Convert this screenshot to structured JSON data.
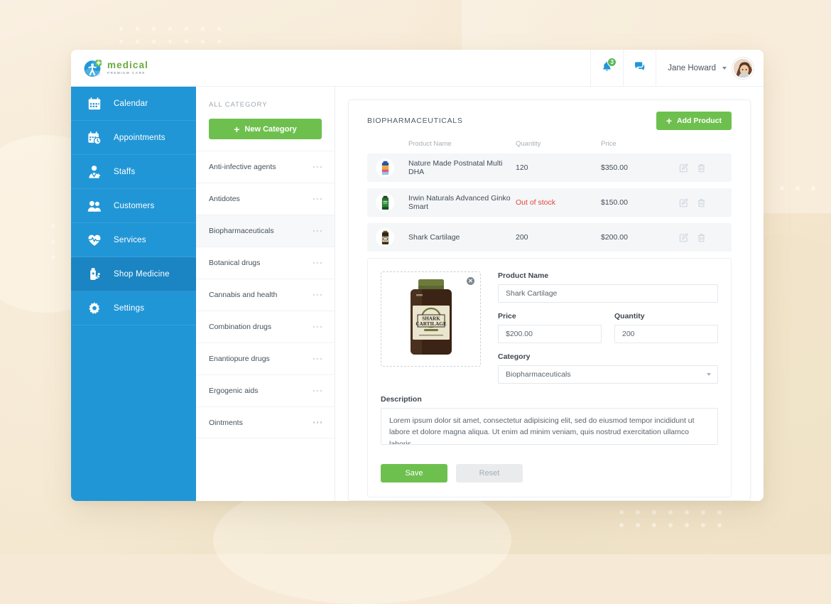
{
  "brand": {
    "title": "medical",
    "subtitle": "PREMIUM CARE",
    "logo_icon": "medical-globe-logo",
    "title_color": "#6aab3f",
    "accent_blue": "#2196d6"
  },
  "topbar": {
    "notifications": {
      "icon": "bell-icon",
      "badge_count": "3",
      "badge_color": "#5cb85c"
    },
    "messages": {
      "icon": "chat-bubble-icon"
    },
    "user": {
      "name": "Jane Howard",
      "caret_icon": "chevron-down-icon",
      "avatar_icon": "user-avatar"
    }
  },
  "sidebar": {
    "background": "#2196d6",
    "active_background": "#1a85c2",
    "items": [
      {
        "label": "Calendar",
        "icon": "calendar-icon",
        "active": false
      },
      {
        "label": "Appointments",
        "icon": "appointments-icon",
        "active": false
      },
      {
        "label": "Staffs",
        "icon": "staff-icon",
        "active": false
      },
      {
        "label": "Customers",
        "icon": "customers-icon",
        "active": false
      },
      {
        "label": "Services",
        "icon": "heart-pulse-icon",
        "active": false
      },
      {
        "label": "Shop Medicine",
        "icon": "medicine-bottle-icon",
        "active": true
      },
      {
        "label": "Settings",
        "icon": "gear-icon",
        "active": false
      }
    ]
  },
  "categories": {
    "header": "ALL CATEGORY",
    "new_button": {
      "label": "New Category",
      "icon": "plus-icon",
      "color": "#6ec04e"
    },
    "menu_icon": "three-dots-icon",
    "items": [
      {
        "label": "Anti-infective agents",
        "active": false
      },
      {
        "label": "Antidotes",
        "active": false
      },
      {
        "label": "Biopharmaceuticals",
        "active": true
      },
      {
        "label": "Botanical drugs",
        "active": false
      },
      {
        "label": "Cannabis and health",
        "active": false
      },
      {
        "label": "Combination drugs",
        "active": false
      },
      {
        "label": "Enantiopure drugs",
        "active": false
      },
      {
        "label": "Ergogenic aids",
        "active": false
      },
      {
        "label": "Ointments",
        "active": false
      }
    ]
  },
  "products_panel": {
    "title": "BIOPHARMACEUTICALS",
    "add_button": {
      "label": "Add Product",
      "icon": "plus-icon",
      "color": "#6ec04e"
    },
    "columns": {
      "product_name": "Product Name",
      "quantity": "Quantity",
      "price": "Price"
    },
    "out_of_stock_color": "#e8453c",
    "row_icons": {
      "edit": "edit-square-icon",
      "delete": "trash-icon"
    },
    "rows": [
      {
        "name": "Nature Made Postnatal Multi DHA",
        "quantity": "120",
        "out_of_stock": false,
        "price": "$350.00",
        "thumb": "multivitamin-bottle-yellow"
      },
      {
        "name": "Irwin Naturals Advanced Ginko Smart",
        "quantity": "Out of stock",
        "out_of_stock": true,
        "price": "$150.00",
        "thumb": "ginko-bottle-green"
      },
      {
        "name": "Shark Cartilage",
        "quantity": "200",
        "out_of_stock": false,
        "price": "$200.00",
        "thumb": "shark-cartilage-bottle-brown"
      }
    ]
  },
  "edit_form": {
    "image": {
      "alt": "shark-cartilage-bottle-image",
      "remove_icon": "close-circle-icon",
      "label_line1": "SHARK",
      "label_line2": "CARTILAGE"
    },
    "product_name": {
      "label": "Product Name",
      "value": "Shark Cartilage"
    },
    "price": {
      "label": "Price",
      "value": "$200.00"
    },
    "quantity": {
      "label": "Quantity",
      "value": "200"
    },
    "category": {
      "label": "Category",
      "value": "Biopharmaceuticals",
      "caret_icon": "chevron-down-icon",
      "options": [
        "Anti-infective agents",
        "Antidotes",
        "Biopharmaceuticals",
        "Botanical drugs",
        "Cannabis and health",
        "Combination drugs",
        "Enantiopure drugs",
        "Ergogenic aids",
        "Ointments"
      ]
    },
    "description": {
      "label": "Description",
      "value": "Lorem ipsum dolor sit amet, consectetur adipisicing elit, sed do eiusmod tempor incididunt ut labore et dolore magna aliqua. Ut enim ad minim veniam, quis nostrud exercitation ullamco laboris."
    },
    "save_label": "Save",
    "reset_label": "Reset"
  }
}
